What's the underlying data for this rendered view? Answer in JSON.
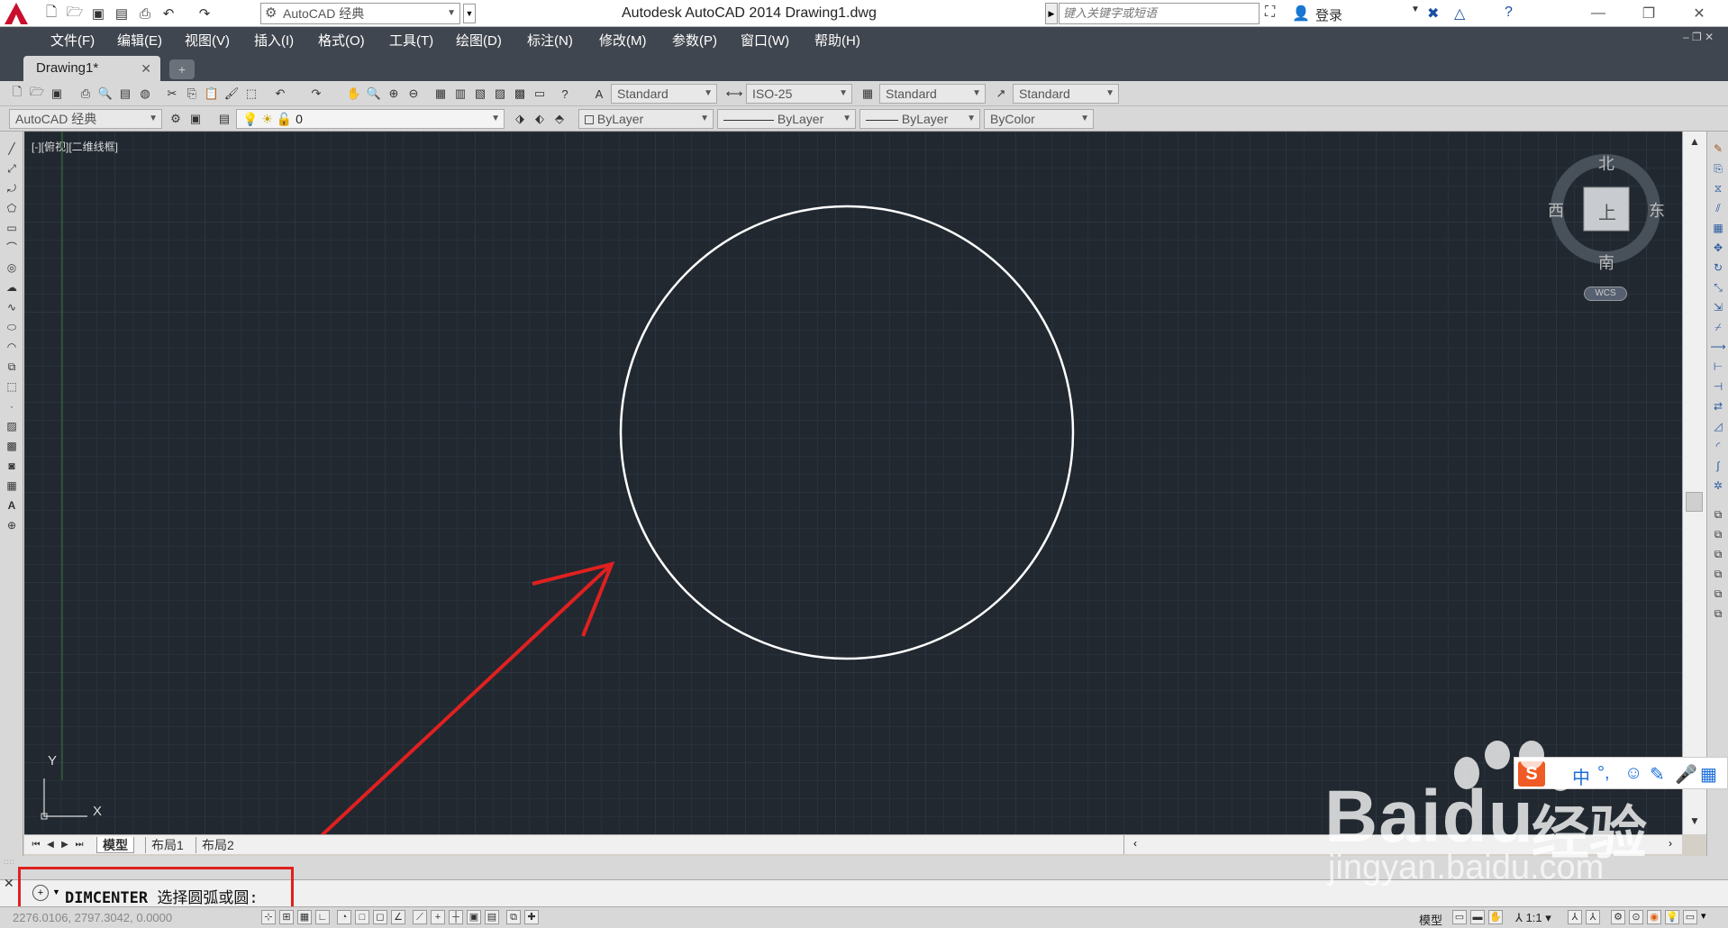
{
  "titlebar": {
    "workspace": "AutoCAD 经典",
    "title": "Autodesk AutoCAD 2014    Drawing1.dwg",
    "search_placeholder": "键入关键字或短语",
    "login": "登录",
    "win_min": "—",
    "win_max": "❐",
    "win_close": "✕"
  },
  "menu": [
    "文件(F)",
    "编辑(E)",
    "视图(V)",
    "插入(I)",
    "格式(O)",
    "工具(T)",
    "绘图(D)",
    "标注(N)",
    "修改(M)",
    "参数(P)",
    "窗口(W)",
    "帮助(H)"
  ],
  "tabs": {
    "drawing": "Drawing1*",
    "close": "✕",
    "add": "+"
  },
  "styles": {
    "text_style": "Standard",
    "dim_style": "ISO-25",
    "table_style": "Standard",
    "mleader_style": "Standard"
  },
  "layers": {
    "workspace": "AutoCAD 经典",
    "layer": "0",
    "color": "ByLayer",
    "linetype": "ByLayer",
    "lineweight": "ByLayer",
    "plotstyle": "ByColor"
  },
  "viewport": {
    "label": "[-][俯视][二维线框]",
    "compass": {
      "north": "北",
      "south": "南",
      "east": "东",
      "west": "西",
      "top": "上"
    },
    "wcs": "WCS",
    "ucs_x": "X",
    "ucs_y": "Y"
  },
  "layout_tabs": [
    "模型",
    "布局1",
    "布局2"
  ],
  "command": {
    "name": "DIMCENTER",
    "prompt": "选择圆弧或圆:"
  },
  "status": {
    "coords": "2276.0106, 2797.3042, 0.0000",
    "model": "模型",
    "scale": "1:1"
  },
  "ime": {
    "s": "S",
    "lang": "中"
  },
  "watermark": {
    "logo": "Bai",
    "logo_du": "du",
    "jingyan": "经验",
    "url": "jingyan.baidu.com"
  },
  "colors": {
    "canvas": "#212830",
    "menubar": "#40464f",
    "annotation_red": "#e02020",
    "circle": "#ffffff"
  }
}
